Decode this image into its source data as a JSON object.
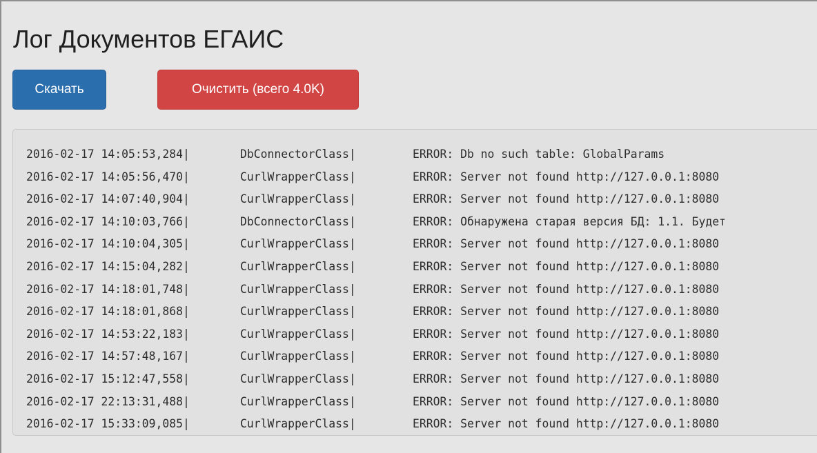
{
  "page": {
    "title": "Лог Документов ЕГАИС"
  },
  "toolbar": {
    "download_label": "Скачать",
    "clear_label": "Очистить (всего 4.0K)"
  },
  "colors": {
    "background": "#e6e6e6",
    "download_button": "#2b6ead",
    "clear_button": "#d24545",
    "log_box": "#e1e1e1"
  },
  "log": {
    "entries": [
      {
        "timestamp": "2016-02-17 14:05:53,284|",
        "source": "DbConnectorClass|",
        "message": "ERROR: Db no such table: GlobalParams"
      },
      {
        "timestamp": "2016-02-17 14:05:56,470|",
        "source": "CurlWrapperClass|",
        "message": "ERROR: Server not found http://127.0.0.1:8080"
      },
      {
        "timestamp": "2016-02-17 14:07:40,904|",
        "source": "CurlWrapperClass|",
        "message": "ERROR: Server not found http://127.0.0.1:8080"
      },
      {
        "timestamp": "2016-02-17 14:10:03,766|",
        "source": "DbConnectorClass|",
        "message": "ERROR: Обнаружена старая версия БД: 1.1. Будет"
      },
      {
        "timestamp": "2016-02-17 14:10:04,305|",
        "source": "CurlWrapperClass|",
        "message": "ERROR: Server not found http://127.0.0.1:8080"
      },
      {
        "timestamp": "2016-02-17 14:15:04,282|",
        "source": "CurlWrapperClass|",
        "message": "ERROR: Server not found http://127.0.0.1:8080"
      },
      {
        "timestamp": "2016-02-17 14:18:01,748|",
        "source": "CurlWrapperClass|",
        "message": "ERROR: Server not found http://127.0.0.1:8080"
      },
      {
        "timestamp": "2016-02-17 14:18:01,868|",
        "source": "CurlWrapperClass|",
        "message": "ERROR: Server not found http://127.0.0.1:8080"
      },
      {
        "timestamp": "2016-02-17 14:53:22,183|",
        "source": "CurlWrapperClass|",
        "message": "ERROR: Server not found http://127.0.0.1:8080"
      },
      {
        "timestamp": "2016-02-17 14:57:48,167|",
        "source": "CurlWrapperClass|",
        "message": "ERROR: Server not found http://127.0.0.1:8080"
      },
      {
        "timestamp": "2016-02-17 15:12:47,558|",
        "source": "CurlWrapperClass|",
        "message": "ERROR: Server not found http://127.0.0.1:8080"
      },
      {
        "timestamp": "2016-02-17 22:13:31,488|",
        "source": "CurlWrapperClass|",
        "message": "ERROR: Server not found http://127.0.0.1:8080"
      },
      {
        "timestamp": "2016-02-17 15:33:09,085|",
        "source": "CurlWrapperClass|",
        "message": "ERROR: Server not found http://127.0.0.1:8080"
      }
    ]
  }
}
